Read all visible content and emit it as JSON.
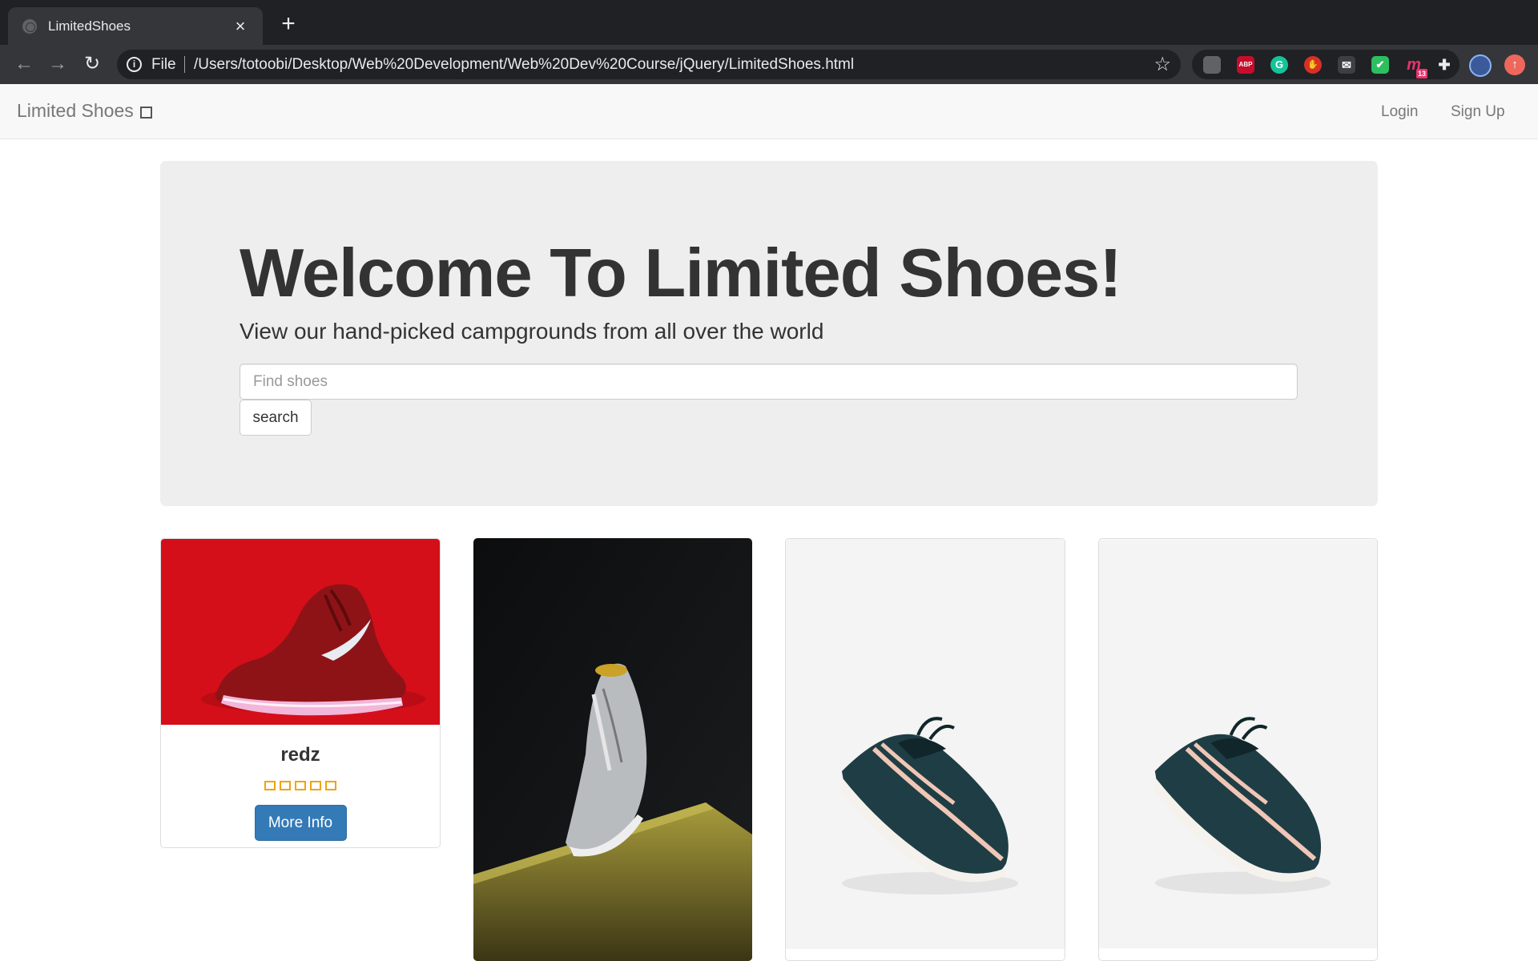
{
  "browser": {
    "tab_title": "LimitedShoes",
    "tab_close": "×",
    "new_tab": "+",
    "scheme_label": "File",
    "url": "/Users/totoobi/Desktop/Web%20Development/Web%20Dev%20Course/jQuery/LimitedShoes.html",
    "back": "←",
    "forward": "→",
    "reload": "↻",
    "star": "☆",
    "extensions": [
      {
        "name": "dog-extension-icon",
        "text": "",
        "color": "#5f6368"
      },
      {
        "name": "adblock-plus-icon",
        "text": "ABP",
        "color": "#c70d2c"
      },
      {
        "name": "grammarly-icon",
        "text": "G",
        "color": "#15c39a"
      },
      {
        "name": "stop-hand-icon",
        "text": "✋",
        "color": "#d93025"
      },
      {
        "name": "mail-check-icon",
        "text": "✉",
        "color": "#3c4043"
      },
      {
        "name": "evernote-icon",
        "text": "✔",
        "color": "#2dbe60"
      },
      {
        "name": "notification-m-icon",
        "text": "m",
        "color": "#e8336d",
        "badge": "13"
      },
      {
        "name": "puzzle-icon",
        "text": "✚",
        "color": "#5f6368"
      }
    ]
  },
  "navbar": {
    "brand": "Limited Shoes",
    "login": "Login",
    "signup": "Sign Up"
  },
  "jumbotron": {
    "title": "Welcome To Limited Shoes!",
    "subtitle": "View our hand-picked campgrounds from all over the world",
    "search_placeholder": "Find shoes",
    "search_button": "search"
  },
  "cards": [
    {
      "title": "redz",
      "rating_stars": 5,
      "button": "More Info",
      "image": "red-nike-sneaker"
    },
    {
      "image": "grey-adidas-sneaker-on-ledge"
    },
    {
      "image": "teal-air-max-sneaker"
    },
    {
      "image": "teal-air-max-sneaker"
    }
  ],
  "colors": {
    "chrome_dark": "#202124",
    "chrome_tab": "#35363a",
    "navbar_bg": "#f8f8f8",
    "jumbotron_bg": "#eeeeee",
    "primary_button": "#337ab7",
    "star_outline": "#f0a30a"
  }
}
